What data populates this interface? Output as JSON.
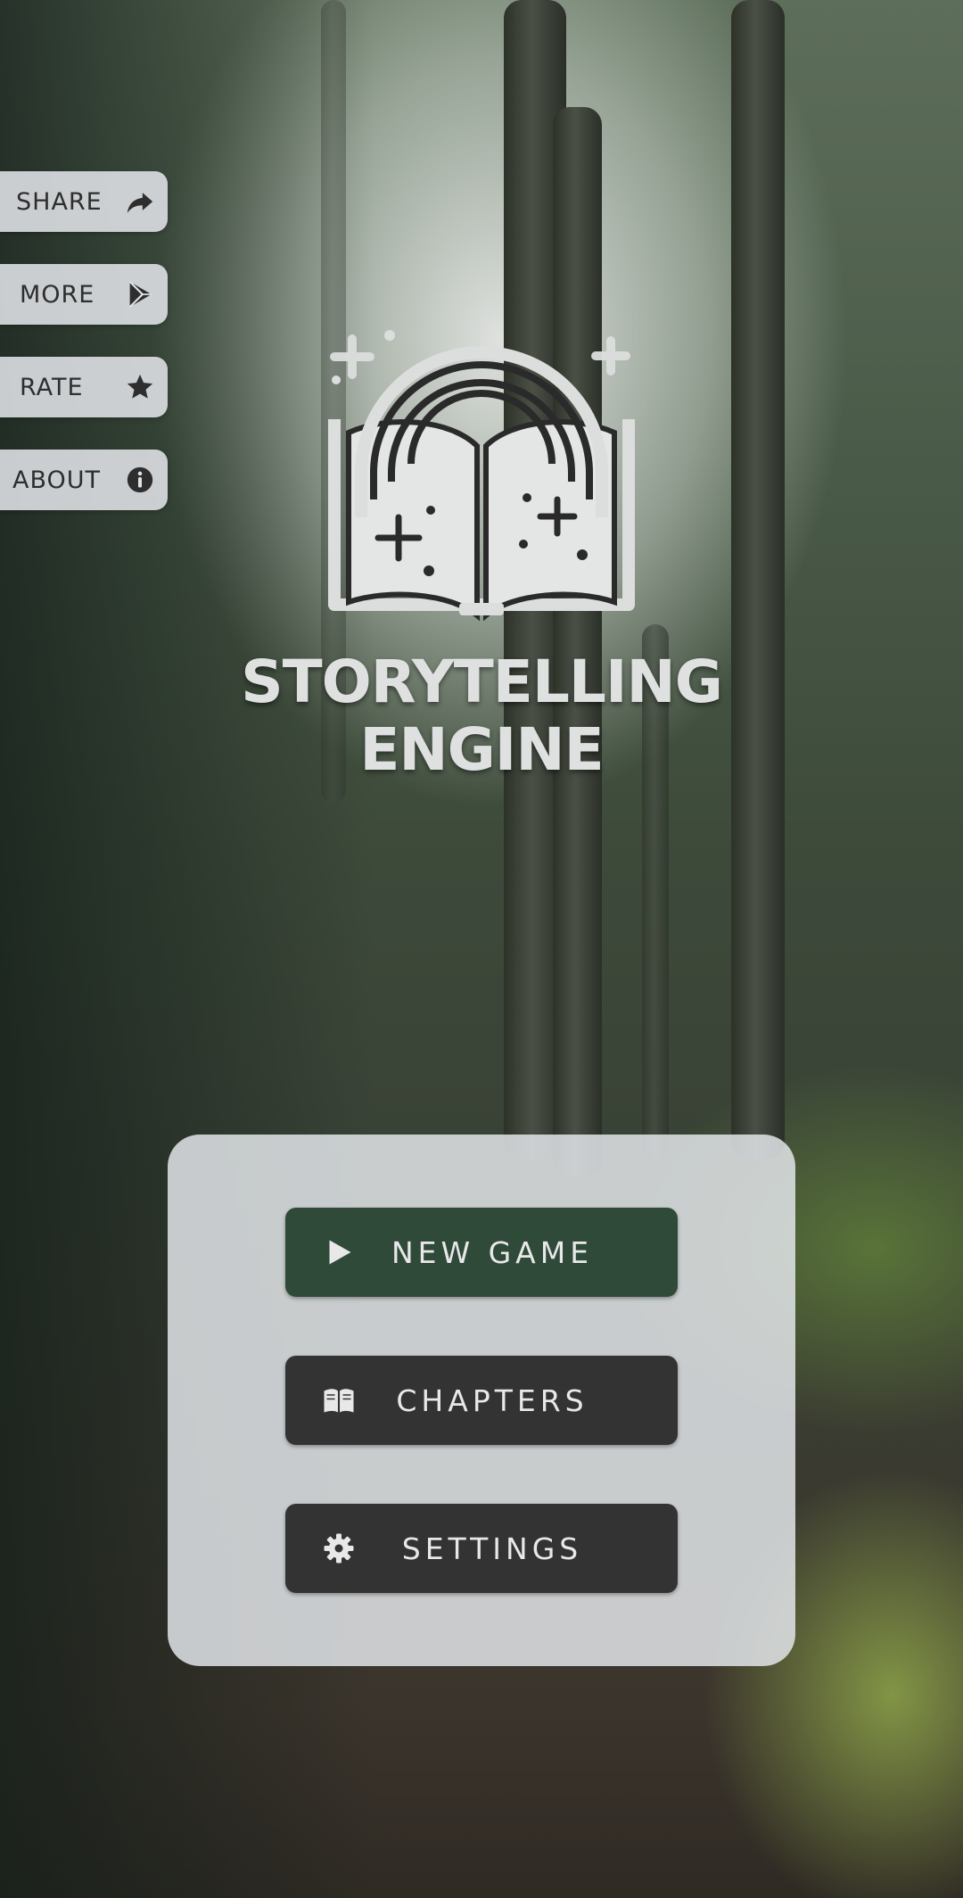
{
  "app": {
    "title_line1": "STORYTELLING",
    "title_line2": "ENGINE"
  },
  "side_menu": [
    {
      "label": "SHARE",
      "icon": "share-arrow-icon"
    },
    {
      "label": "MORE",
      "icon": "play-store-icon"
    },
    {
      "label": "RATE",
      "icon": "star-icon"
    },
    {
      "label": "ABOUT",
      "icon": "info-icon"
    }
  ],
  "main_menu": {
    "new_game": {
      "label": "NEW GAME",
      "icon": "play-icon",
      "color": "#304a3a"
    },
    "chapters": {
      "label": "CHAPTERS",
      "icon": "open-book-icon",
      "color": "#333333"
    },
    "settings": {
      "label": "SETTINGS",
      "icon": "gear-icon",
      "color": "#333333"
    }
  },
  "colors": {
    "panel": "#e1e4e8",
    "side_button": "#e1e4e8",
    "title_text": "#dfe0e0"
  }
}
